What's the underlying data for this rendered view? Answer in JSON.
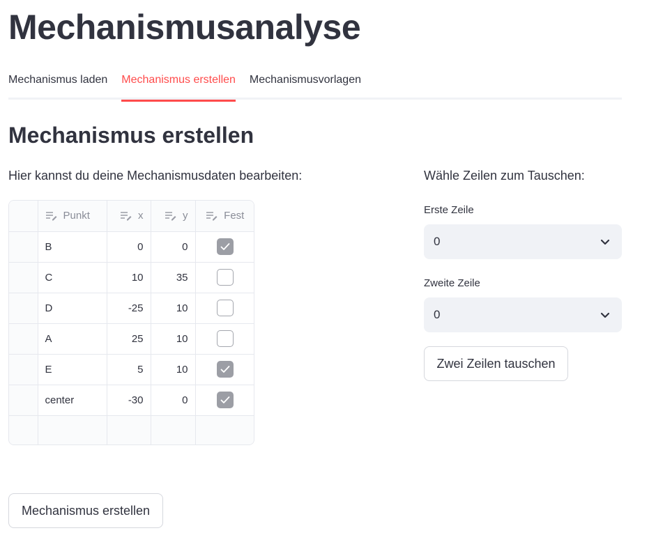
{
  "app": {
    "title": "Mechanismusanalyse"
  },
  "tabs": [
    {
      "label": "Mechanismus laden",
      "active": false
    },
    {
      "label": "Mechanismus erstellen",
      "active": true
    },
    {
      "label": "Mechanismusvorlagen",
      "active": false
    }
  ],
  "main": {
    "section_title": "Mechanismus erstellen",
    "intro": "Hier kannst du deine Mechanismusdaten bearbeiten:"
  },
  "table": {
    "columns": [
      "Punkt",
      "x",
      "y",
      "Fest"
    ],
    "rows": [
      {
        "punkt": "B",
        "x": "0",
        "y": "0",
        "fest": true
      },
      {
        "punkt": "C",
        "x": "10",
        "y": "35",
        "fest": false
      },
      {
        "punkt": "D",
        "x": "-25",
        "y": "10",
        "fest": false
      },
      {
        "punkt": "A",
        "x": "25",
        "y": "10",
        "fest": false
      },
      {
        "punkt": "E",
        "x": "5",
        "y": "10",
        "fest": true
      },
      {
        "punkt": "center",
        "x": "-30",
        "y": "0",
        "fest": true
      }
    ]
  },
  "swap": {
    "heading": "Wähle Zeilen zum Tauschen:",
    "first_label": "Erste Zeile",
    "first_value": "0",
    "second_label": "Zweite Zeile",
    "second_value": "0",
    "swap_button": "Zwei Zeilen tauschen"
  },
  "actions": {
    "create_button": "Mechanismus erstellen"
  },
  "colors": {
    "accent": "#ff4b4b",
    "text": "#31333f",
    "input_bg": "#f0f2f6",
    "checkbox_checked": "#9c9ea5"
  }
}
